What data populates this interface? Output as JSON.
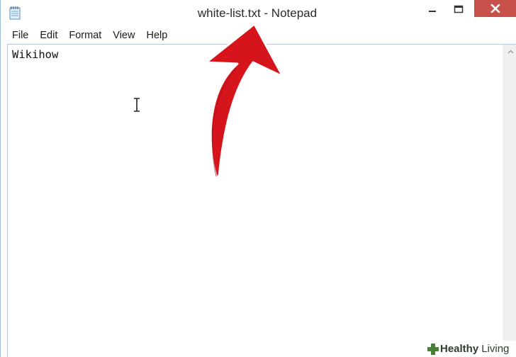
{
  "window": {
    "title": "white-list.txt - Notepad",
    "app_icon": "notepad-icon",
    "controls": [
      "minimize-icon",
      "maximize-icon",
      "close-icon"
    ],
    "close_color": "#c7504b"
  },
  "menu": {
    "items": [
      {
        "label": "File"
      },
      {
        "label": "Edit"
      },
      {
        "label": "Format"
      },
      {
        "label": "View"
      },
      {
        "label": "Help"
      }
    ]
  },
  "editor": {
    "content": "Wikihow",
    "scrollbar_icon": "scroll-up-arrow-icon",
    "cursor_icon": "i-beam-cursor-icon"
  },
  "annotation": {
    "icon": "red-arrow-icon",
    "color": "#d6141c"
  },
  "watermark": {
    "part1": "Healthy",
    "part2": "Living",
    "icon": "plus-logo-icon"
  }
}
